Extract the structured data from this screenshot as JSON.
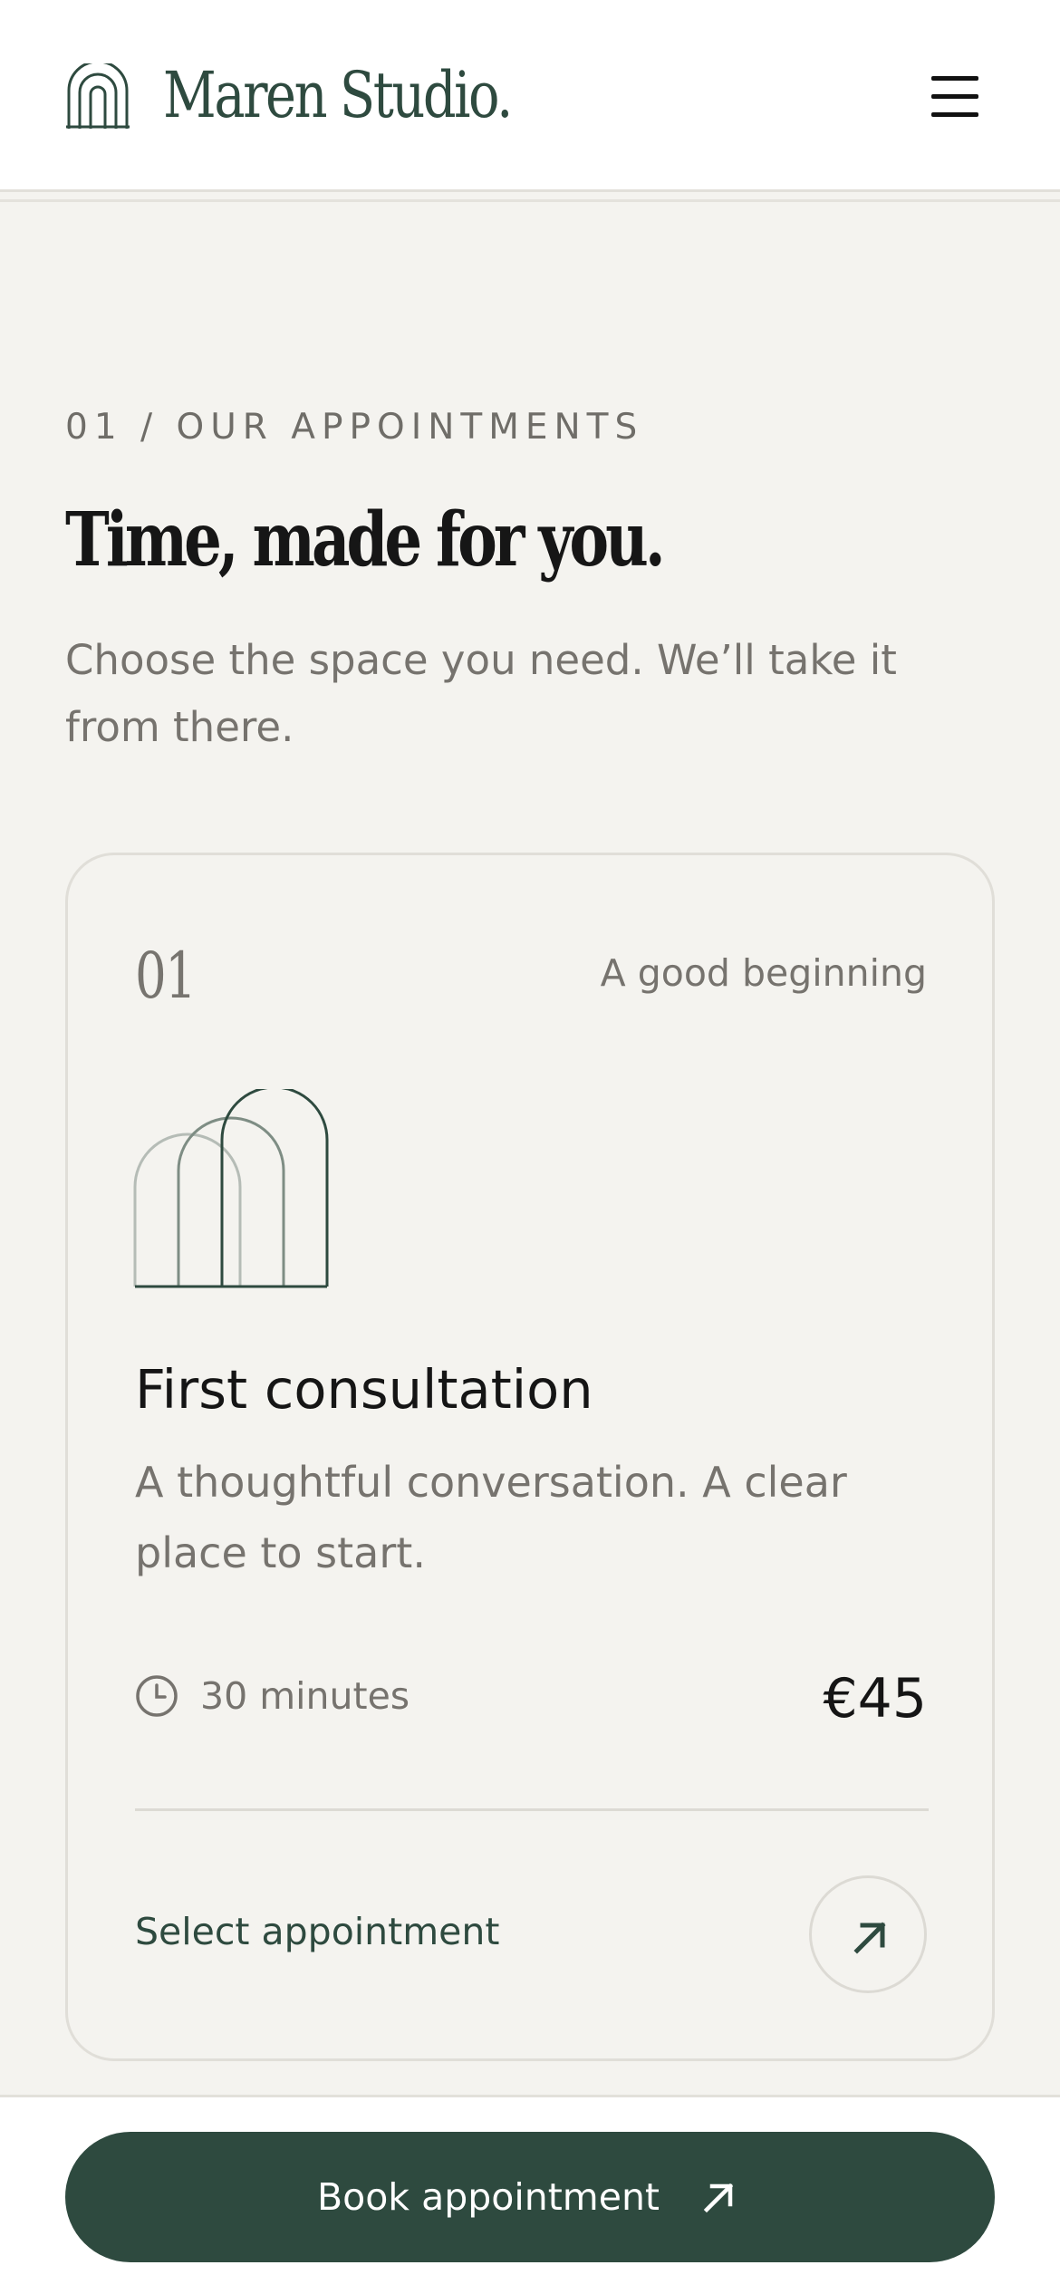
{
  "header": {
    "brand": "Maren Studio.",
    "logo_icon": "arch-logo-icon",
    "menu_icon": "hamburger-menu-icon"
  },
  "section": {
    "eyebrow": "01 / OUR APPOINTMENTS",
    "title": "Time, made for you.",
    "intro": "Choose the space you need. We’ll take it from there."
  },
  "card": {
    "number": "01",
    "tag": "A good beginning",
    "illustration_icon": "arches-icon",
    "title": "First consultation",
    "description": "A thoughtful conversation. A clear place to start.",
    "duration_icon": "clock-icon",
    "duration": "30 minutes",
    "price": "€45",
    "select_label": "Select appointment",
    "select_icon": "arrow-up-right-icon"
  },
  "footer": {
    "book_label": "Book appointment",
    "book_icon": "arrow-up-right-icon"
  },
  "colors": {
    "brand_green": "#2e4a3f",
    "background": "#f4f3ef",
    "muted_text": "#76736e"
  }
}
